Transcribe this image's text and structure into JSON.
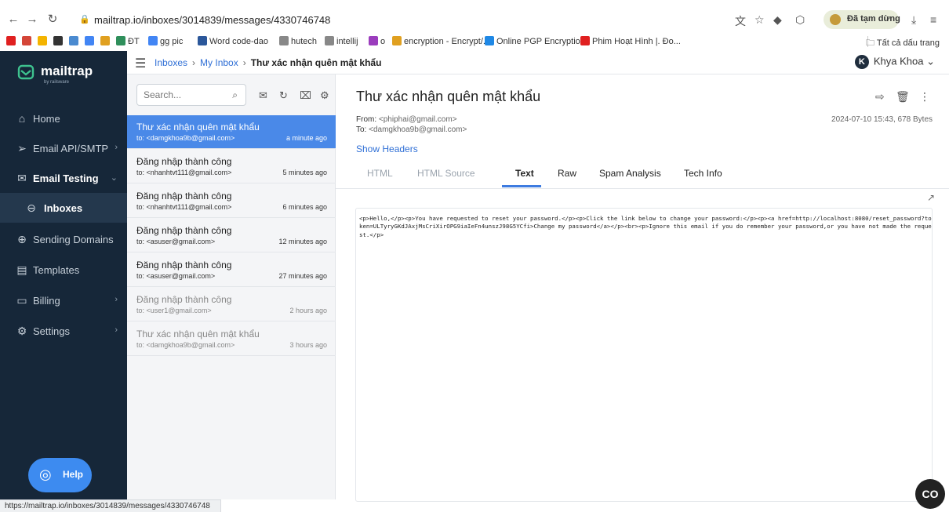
{
  "browser": {
    "url": "mailtrap.io/inboxes/3014839/messages/4330746748",
    "pause_label": "Đã tạm dừng",
    "bookmarks": [
      {
        "label": "ĐT",
        "color": "#2f8f5b"
      },
      {
        "label": "gg pic",
        "color": "#4285f4"
      },
      {
        "label": "Word code-dao",
        "color": "#2b579a"
      },
      {
        "label": "hutech",
        "color": "#888888"
      },
      {
        "label": "intellij",
        "color": "#888888"
      },
      {
        "label": "o",
        "color": "#9b3dbd"
      },
      {
        "label": "encryption - Encrypt/...",
        "color": "#e0a020"
      },
      {
        "label": "Online PGP Encryptio...",
        "color": "#1f88e5"
      },
      {
        "label": "Phim Hoạt Hình |. Đo...",
        "color": "#e02020"
      }
    ],
    "all_bookmarks_label": "Tất cả dấu trang",
    "status_url": "https://mailtrap.io/inboxes/3014839/messages/4330746748"
  },
  "brand": {
    "name": "mailtrap",
    "sub": "by railsware",
    "sidebar_bg": "#162739",
    "accent": "#4a89e8"
  },
  "sidebar": {
    "items": [
      {
        "label": "Home",
        "icon": "home-icon"
      },
      {
        "label": "Email API/SMTP",
        "icon": "send-icon"
      },
      {
        "label": "Email Testing",
        "icon": "envelope-check-icon"
      },
      {
        "label": "Inboxes",
        "icon": "inbox-icon"
      },
      {
        "label": "Sending Domains",
        "icon": "globe-icon"
      },
      {
        "label": "Templates",
        "icon": "template-icon"
      },
      {
        "label": "Billing",
        "icon": "card-icon"
      },
      {
        "label": "Settings",
        "icon": "gear-icon"
      }
    ],
    "help_label": "Help"
  },
  "topbar": {
    "crumbs": [
      "Inboxes",
      "My Inbox",
      "Thư xác nhận quên mật khẩu"
    ],
    "user_initial": "K",
    "user_name": "Khya Khoa"
  },
  "list": {
    "search_placeholder": "Search...",
    "messages": [
      {
        "subject": "Thư xác nhận quên mật khẩu",
        "to": "to: <damgkhoa9b@gmail.com>",
        "time": "a minute ago"
      },
      {
        "subject": "Đăng nhập thành công",
        "to": "to: <nhanhtvt111@gmail.com>",
        "time": "5 minutes ago"
      },
      {
        "subject": "Đăng nhập thành công",
        "to": "to: <nhanhtvt111@gmail.com>",
        "time": "6 minutes ago"
      },
      {
        "subject": "Đăng nhập thành công",
        "to": "to: <asuser@gmail.com>",
        "time": "12 minutes ago"
      },
      {
        "subject": "Đăng nhập thành công",
        "to": "to: <asuser@gmail.com>",
        "time": "27 minutes ago"
      },
      {
        "subject": "Đăng nhập thành công",
        "to": "to: <user1@gmail.com>",
        "time": "2 hours ago"
      },
      {
        "subject": "Thư xác nhận quên mật khẩu",
        "to": "to: <damgkhoa9b@gmail.com>",
        "time": "3 hours ago"
      }
    ]
  },
  "view": {
    "subject": "Thư xác nhận quên mật khẩu",
    "from_label": "From:",
    "from_value": "<phiphai@gmail.com>",
    "to_label": "To:",
    "to_value": "<damgkhoa9b@gmail.com>",
    "meta": "2024-07-10 15:43, 678 Bytes",
    "show_headers": "Show Headers",
    "tabs": [
      "HTML",
      "HTML Source",
      "Text",
      "Raw",
      "Spam Analysis",
      "Tech Info"
    ],
    "body": "<p>Hello,</p><p>You have requested to reset your password.</p><p>Click the link below to change your password:</p><p><a href=http://localhost:8080/reset_password?token=ULTyryGKdJAxjMsCriXirOPG9iaIeFn4unszJ98G5YCfi>Change my password</a></p><br><p>Ignore this email if you do remember your password,or you have not made the request.</p>",
    "chat_label": "CO"
  }
}
